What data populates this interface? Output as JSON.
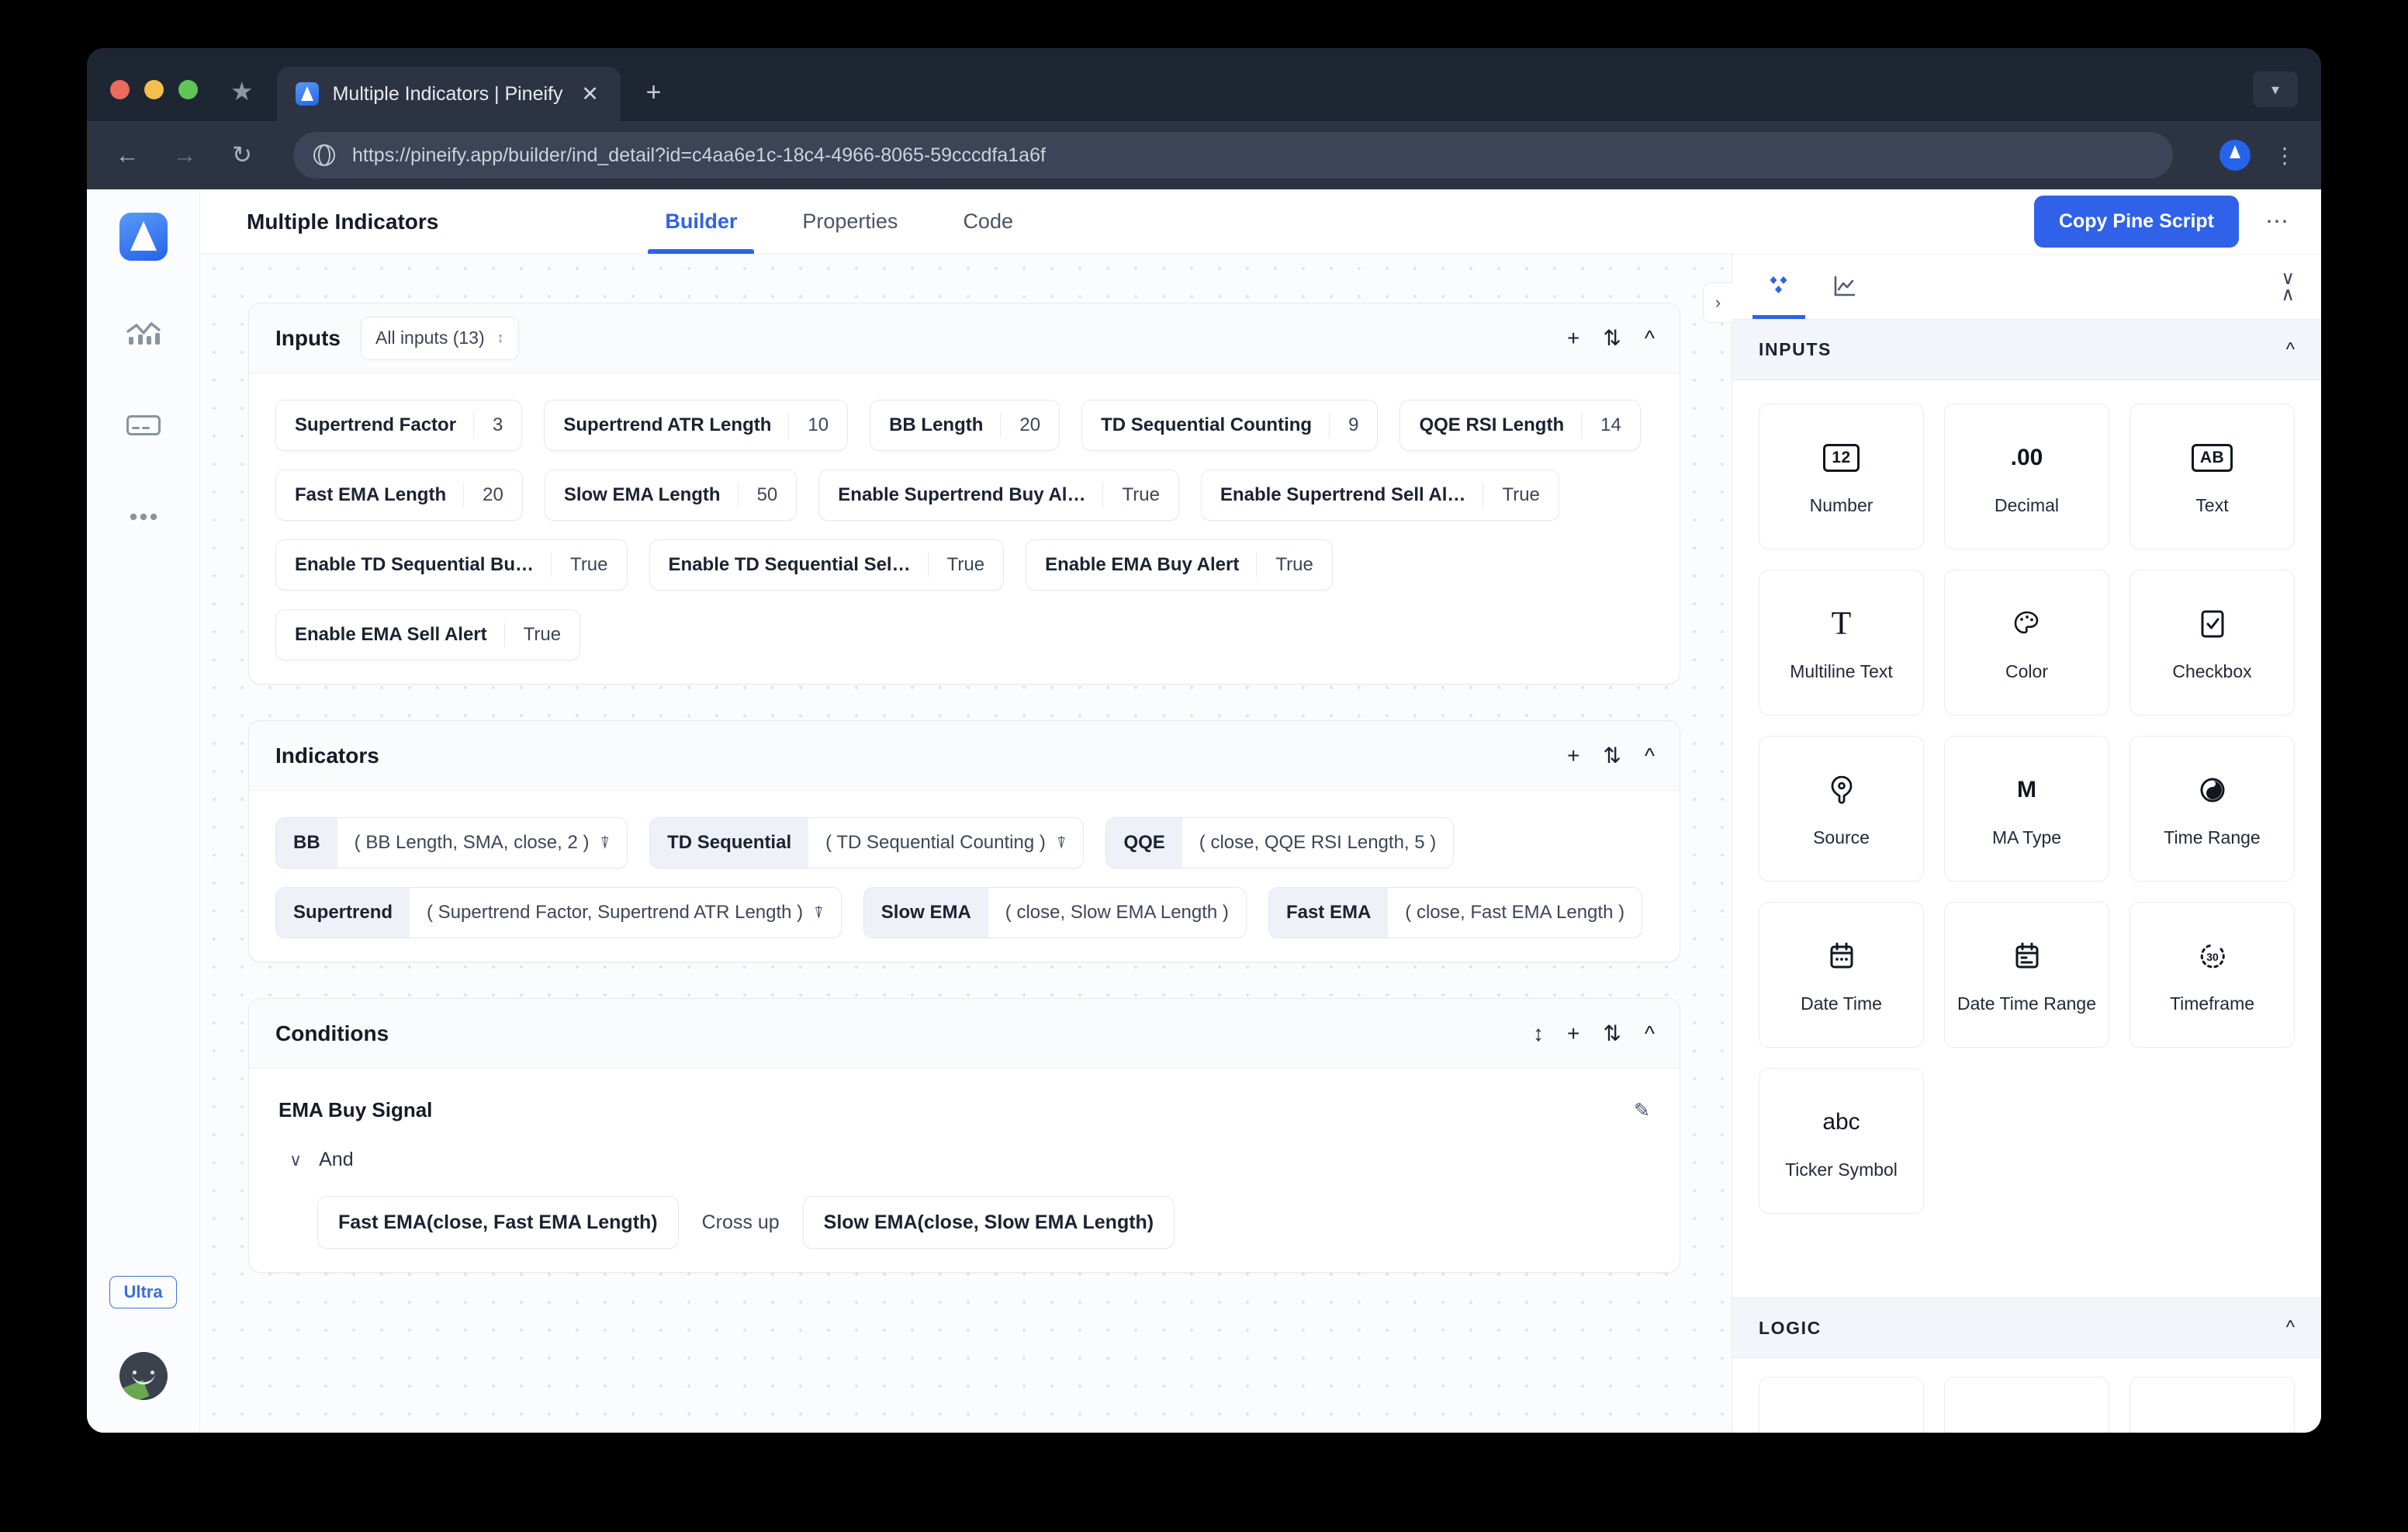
{
  "browser": {
    "tab": {
      "title": "Multiple Indicators | Pineify",
      "favicon_icon": "pine-tree-icon",
      "close_icon": "close-icon"
    },
    "new_tab_label": "+",
    "bookmark_icon": "star-icon",
    "back_icon": "arrow-left-icon",
    "forward_icon": "arrow-right-icon",
    "reload_icon": "reload-icon",
    "site_icon": "globe-icon",
    "url": "https://pineify.app/builder/ind_detail?id=c4aa6e1c-18c4-4966-8065-59cccdfa1a6f",
    "profile_icon": "profile-avatar-icon",
    "menu_icon": "kebab-menu-icon",
    "window_list_icon": "chevron-down-icon"
  },
  "rail": {
    "logo_icon": "pineify-logo-icon",
    "items": [
      {
        "icon": "chart-bars-icon",
        "name": "sidebar-item-charts"
      },
      {
        "icon": "card-icon",
        "name": "sidebar-item-billing"
      },
      {
        "icon": "ellipsis-icon",
        "name": "sidebar-item-more"
      }
    ],
    "plan_badge": "Ultra",
    "avatar_icon": "user-avatar-icon"
  },
  "header": {
    "title": "Multiple Indicators",
    "tabs": [
      {
        "label": "Builder",
        "active": true
      },
      {
        "label": "Properties",
        "active": false
      },
      {
        "label": "Code",
        "active": false
      }
    ],
    "copy_button": "Copy Pine Script",
    "more_icon": "ellipsis-icon",
    "accent_color": "#2f62e8"
  },
  "sections": {
    "inputs": {
      "title": "Inputs",
      "filter_value": "All inputs (13)",
      "actions": [
        "add-icon",
        "sort-icon",
        "collapse-icon"
      ],
      "chips": [
        {
          "label": "Supertrend Factor",
          "value": "3"
        },
        {
          "label": "Supertrend ATR Length",
          "value": "10"
        },
        {
          "label": "BB Length",
          "value": "20"
        },
        {
          "label": "TD Sequential Counting",
          "value": "9"
        },
        {
          "label": "QQE RSI Length",
          "value": "14"
        },
        {
          "label": "Fast EMA Length",
          "value": "20"
        },
        {
          "label": "Slow EMA Length",
          "value": "50"
        },
        {
          "label": "Enable Supertrend Buy Al…",
          "value": "True"
        },
        {
          "label": "Enable Supertrend Sell Al…",
          "value": "True"
        },
        {
          "label": "Enable TD Sequential Bu…",
          "value": "True"
        },
        {
          "label": "Enable TD Sequential Sel…",
          "value": "True"
        },
        {
          "label": "Enable EMA Buy Alert",
          "value": "True"
        },
        {
          "label": "Enable EMA Sell Alert",
          "value": "True"
        }
      ]
    },
    "indicators": {
      "title": "Indicators",
      "actions": [
        "add-icon",
        "sort-icon",
        "collapse-icon"
      ],
      "chips": [
        {
          "name": "BB",
          "args": "( BB Length, SMA, close, 2 )",
          "plot": true
        },
        {
          "name": "TD Sequential",
          "args": "( TD Sequential Counting )",
          "plot": true
        },
        {
          "name": "QQE",
          "args": "( close, QQE RSI Length, 5 )",
          "plot": false
        },
        {
          "name": "Supertrend",
          "args": "( Supertrend Factor, Supertrend ATR Length )",
          "plot": true
        },
        {
          "name": "Slow EMA",
          "args": "( close, Slow EMA Length )",
          "plot": false
        },
        {
          "name": "Fast EMA",
          "args": "( close, Fast EMA Length )",
          "plot": false
        }
      ]
    },
    "conditions": {
      "title": "Conditions",
      "actions": [
        "reorder-icon",
        "add-icon",
        "sort-icon",
        "collapse-icon"
      ],
      "items": [
        {
          "name": "EMA Buy Signal",
          "edit_icon": "pencil-icon",
          "logic": "And",
          "expression": {
            "left": "Fast EMA(close, Fast EMA Length)",
            "operator": "Cross up",
            "right": "Slow EMA(close, Slow EMA Length)"
          }
        }
      ]
    }
  },
  "panel": {
    "collapse_handle_icon": "chevron-right-icon",
    "tabs": [
      {
        "icon": "blocks-icon",
        "active": true
      },
      {
        "icon": "line-chart-icon",
        "active": false
      }
    ],
    "collapse_all_icon": "collapse-all-icon",
    "inputs_section": {
      "title": "INPUTS",
      "chevron": "chevron-up-icon",
      "items": [
        {
          "label": "Number",
          "icon": "number-box-icon",
          "glyph": "12"
        },
        {
          "label": "Decimal",
          "icon": "decimal-icon",
          "glyph": ".00"
        },
        {
          "label": "Text",
          "icon": "text-box-icon",
          "glyph": "AB"
        },
        {
          "label": "Multiline Text",
          "icon": "multiline-text-icon",
          "glyph": "T"
        },
        {
          "label": "Color",
          "icon": "palette-icon",
          "glyph": ""
        },
        {
          "label": "Checkbox",
          "icon": "checkbox-icon",
          "glyph": ""
        },
        {
          "label": "Source",
          "icon": "source-pin-icon",
          "glyph": ""
        },
        {
          "label": "MA Type",
          "icon": "ma-type-icon",
          "glyph": "M"
        },
        {
          "label": "Time Range",
          "icon": "time-range-icon",
          "glyph": ""
        },
        {
          "label": "Date Time",
          "icon": "calendar-icon",
          "glyph": ""
        },
        {
          "label": "Date Time Range",
          "icon": "calendar-range-icon",
          "glyph": ""
        },
        {
          "label": "Timeframe",
          "icon": "timeframe-icon",
          "glyph": "30"
        },
        {
          "label": "Ticker Symbol",
          "icon": "ticker-symbol-icon",
          "glyph": "abc"
        }
      ]
    },
    "logic_section": {
      "title": "LOGIC",
      "chevron": "chevron-up-icon"
    }
  }
}
